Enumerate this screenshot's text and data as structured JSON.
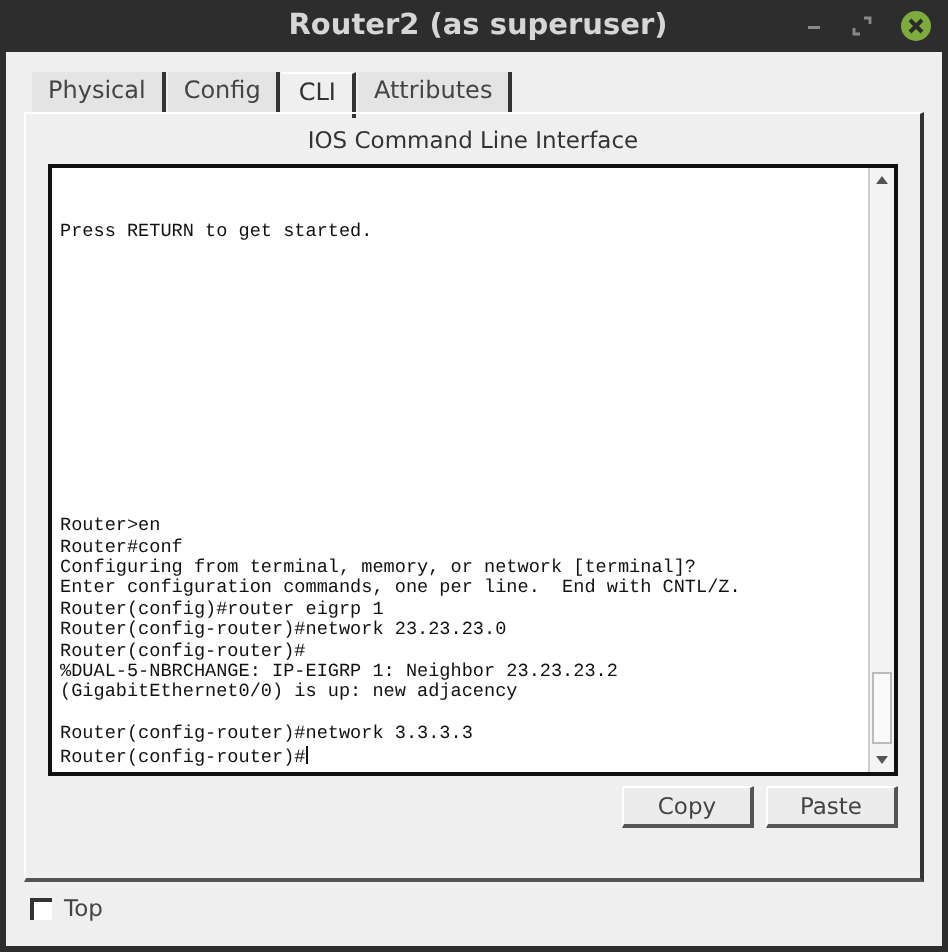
{
  "window": {
    "title": "Router2 (as superuser)"
  },
  "tabs": [
    {
      "label": "Physical",
      "selected": false
    },
    {
      "label": "Config",
      "selected": false
    },
    {
      "label": "CLI",
      "selected": true
    },
    {
      "label": "Attributes",
      "selected": false
    }
  ],
  "panel": {
    "heading": "IOS Command Line Interface"
  },
  "terminal": {
    "top_lines": [
      {
        "text": "Press RETURN to get started.",
        "cursor": false
      }
    ],
    "bottom_blocks": [
      [
        {
          "text": "Router>en",
          "cursor": false
        },
        {
          "text": "Router#conf",
          "cursor": false
        },
        {
          "text": "Configuring from terminal, memory, or network [terminal]?",
          "cursor": false
        },
        {
          "text": "Enter configuration commands, one per line.  End with CNTL/Z.",
          "cursor": false
        },
        {
          "text": "Router(config)#router eigrp 1",
          "cursor": false
        },
        {
          "text": "Router(config-router)#network 23.23.23.0",
          "cursor": false
        },
        {
          "text": "Router(config-router)#",
          "cursor": false
        },
        {
          "text": "%DUAL-5-NBRCHANGE: IP-EIGRP 1: Neighbor 23.23.23.2",
          "cursor": false
        },
        {
          "text": "(GigabitEthernet0/0) is up: new adjacency",
          "cursor": false
        }
      ],
      [
        {
          "text": "Router(config-router)#network 3.3.3.3",
          "cursor": false
        },
        {
          "text": "Router(config-router)#",
          "cursor": true
        }
      ]
    ]
  },
  "buttons": [
    "Copy",
    "Paste"
  ],
  "top_checkbox": {
    "label": "Top",
    "checked": false
  }
}
